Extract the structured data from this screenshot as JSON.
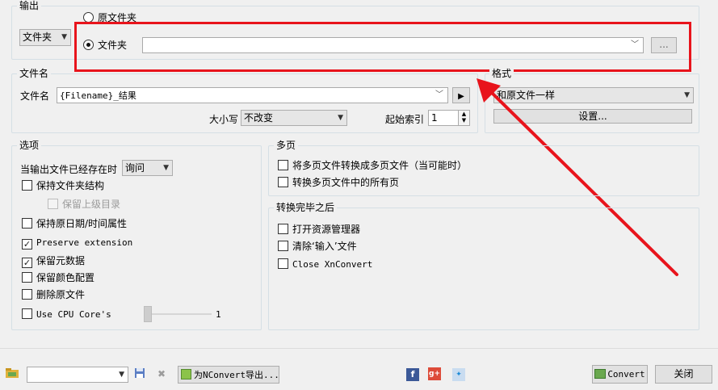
{
  "output": {
    "legend": "输出",
    "folder_type": "文件夹",
    "radio_original": "原文件夹",
    "radio_folder": "文件夹",
    "folder_path": "",
    "browse_label": "..."
  },
  "filename": {
    "legend": "文件名",
    "label": "文件名",
    "pattern": "{Filename}_结果",
    "case_label": "大小写",
    "case_value": "不改变",
    "index_label": "起始索引",
    "index_value": "1"
  },
  "format": {
    "legend": "格式",
    "value": "和原文件一样",
    "settings_label": "设置..."
  },
  "options": {
    "legend": "选项",
    "exists_label": "当输出文件已经存在时",
    "exists_value": "询问",
    "keep_structure": "保持文件夹结构",
    "keep_parent": "保留上级目录",
    "keep_datetime": "保持原日期/时间属性",
    "preserve_extension": "Preserve extension",
    "keep_metadata": "保留元数据",
    "keep_color_profile": "保留颜色配置",
    "delete_original": "删除原文件",
    "use_cpu_cores": "Use CPU Core's",
    "cpu_cores_value": "1"
  },
  "multipage": {
    "legend": "多页",
    "merge": "将多页文件转换成多页文件（当可能时）",
    "convert_all": "转换多页文件中的所有页"
  },
  "after": {
    "legend": "转换完毕之后",
    "open_explorer": "打开资源管理器",
    "clear_input": "清除‘输入’文件",
    "close_app": "Close XnConvert"
  },
  "footer": {
    "export_label": "为NConvert导出...",
    "convert_label": "Convert",
    "close_label": "关闭"
  },
  "colors": {
    "highlight": "#e8141c",
    "group_border": "#d5dfe5"
  }
}
